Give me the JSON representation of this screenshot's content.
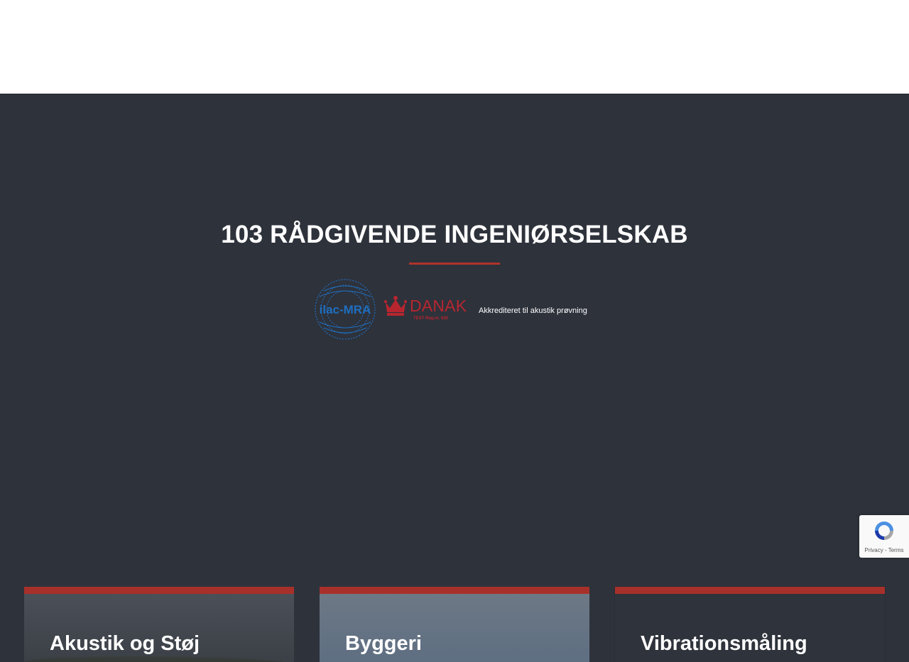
{
  "hero": {
    "title": "103 RÅDGIVENDE INGENIØRSELSKAB",
    "accreditation": {
      "ilac_logo_text": "ilac-MRA",
      "danak_logo_text": "DANAK",
      "danak_reg": "TEST Reg.nr. 620",
      "text": "Akkrediteret til akustik prøvning"
    },
    "accent_color": "#b0332b",
    "background_color": "#2e323b"
  },
  "cards": [
    {
      "title": "Akustik og Støj"
    },
    {
      "title": "Byggeri"
    },
    {
      "title": "Vibrationsmåling"
    }
  ],
  "recaptcha": {
    "icon": "recaptcha-icon",
    "privacy": "Privacy",
    "separator": " - ",
    "terms": "Terms"
  }
}
